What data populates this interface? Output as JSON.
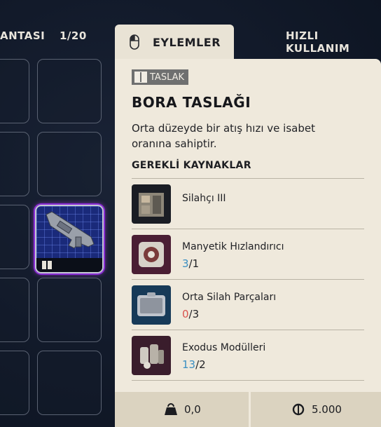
{
  "header": {
    "backpack_label": "ANTASI",
    "capacity": "1/20",
    "quick_use_label": "HIZLI KULLANIM"
  },
  "actions_tab": {
    "label": "EYLEMLER",
    "icon": "mouse-icon"
  },
  "tooltip": {
    "badge": "TASLAK",
    "badge_icon": "book-icon",
    "title": "BORA TASLAĞI",
    "description": "Orta düzeyde bir atış hızı ve isabet oranına sahiptir.",
    "resources_header": "GEREKLİ KAYNAKLAR",
    "resources": [
      {
        "name": "Silahçı III",
        "have": "",
        "need": ""
      },
      {
        "name": "Manyetik Hızlandırıcı",
        "have": "3",
        "need": "/1"
      },
      {
        "name": "Orta Silah Parçaları",
        "have": "0",
        "need": "/3"
      },
      {
        "name": "Exodus Modülleri",
        "have": "13",
        "need": "/2"
      }
    ],
    "weight": "0,0",
    "weight_icon": "weight-icon",
    "price": "5.000",
    "price_icon": "coin-icon"
  },
  "colors": {
    "panel_bg": "#efe9dc",
    "have_ok": "#3a8fc2",
    "have_insufficient": "#d9534f",
    "selected_slot_glow": "#b43ce8"
  }
}
